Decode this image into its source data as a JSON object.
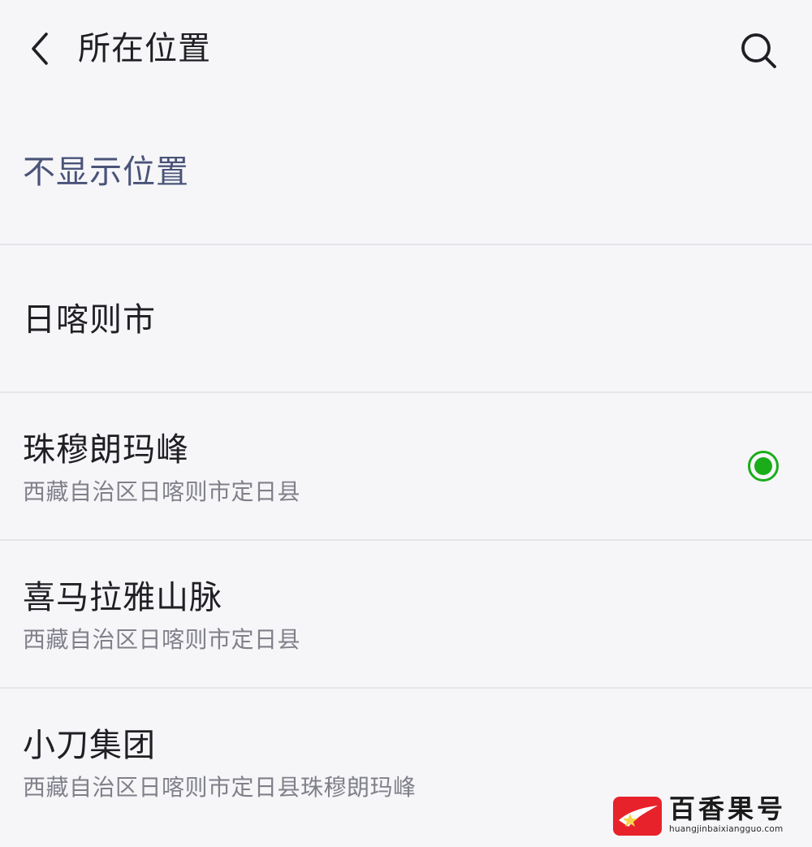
{
  "header": {
    "title": "所在位置"
  },
  "list": {
    "no_location": "不显示位置",
    "city": "日喀则市",
    "places": [
      {
        "name": "珠穆朗玛峰",
        "address": "西藏自治区日喀则市定日县",
        "selected": true
      },
      {
        "name": "喜马拉雅山脉",
        "address": "西藏自治区日喀则市定日县",
        "selected": false
      },
      {
        "name": "小刀集团",
        "address": "西藏自治区日喀则市定日县珠穆朗玛峰",
        "selected": false
      }
    ]
  },
  "watermark": {
    "title": "百香果号",
    "url": "huangjinbaixiangguo.com"
  },
  "colors": {
    "background": "#f6f6f9",
    "divider": "#e6e6ea",
    "radio_green": "#1aad19",
    "secondary_text": "#80808a",
    "no_location_text": "#4a5478"
  },
  "icons": {
    "back": "chevron-left-icon",
    "search": "search-icon",
    "radio": "radio-selected-icon",
    "logo": "watermark-logo-icon"
  }
}
